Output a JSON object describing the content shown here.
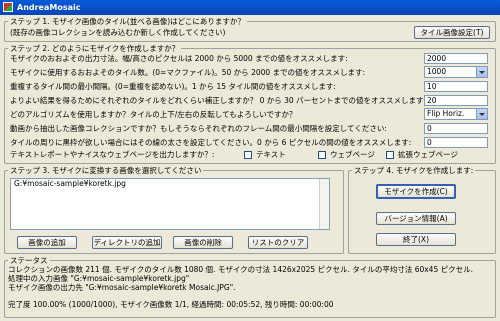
{
  "window": {
    "title": "AndreaMosaic"
  },
  "step1": {
    "legend": "ステップ 1. モザイク画像のタイル(並べる画像)はどこにありますか？",
    "hint": "(既存の画像コレクションを読み込むか新しく作成してください)",
    "button": "タイル画像設定(T)"
  },
  "step2": {
    "legend": "ステップ 2. どのようにモザイクを作成しますか？",
    "rows": [
      {
        "label": "モザイクのおおよその出力寸法。幅/高さのピクセルは 2000 から 5000 までの値をオススメします:",
        "value": "2000",
        "kind": "field"
      },
      {
        "label": "モザイクに使用するおおよそのタイル数。(0=マクファイル)。50 から 2000 までの値をオススメします:",
        "value": "1000",
        "kind": "combo"
      },
      {
        "label": "重複するタイル間の最小間隔。(0=重複を認めない)。1 から 15 タイル間の値をオススメします:",
        "value": "10",
        "kind": "field"
      },
      {
        "label": "よりよい結果を得るためにそれぞれのタイルをどれくらい補正しますか？  0 から 30 パーセントまでの値をオススメします:",
        "value": "20",
        "kind": "field"
      },
      {
        "label": "どのアルゴリズムを使用しますか？タイルの上下/左右の反転してもよろしいですか？",
        "value": "Flip Horiz.",
        "kind": "combo"
      },
      {
        "label": "動画から抽出した画像コレクションですか？もしそうならそれぞれのフレーム間の最小間隔を設定してください:",
        "value": "0",
        "kind": "field"
      },
      {
        "label": "タイルの周りに黒枠が欲しい場合にはその線の太さを設定してください。0 から 6 ピクセルの間の値をオススメします:",
        "value": "0",
        "kind": "field"
      }
    ],
    "text_question": "テキストレポートやナイスなウェブページを出力しますか？:",
    "checks": [
      {
        "label": "テキスト"
      },
      {
        "label": "ウェブページ"
      },
      {
        "label": "拡張ウェブページ"
      }
    ]
  },
  "step3": {
    "legend": "ステップ 3. モザイクに変換する画像を選択してください",
    "list_items": [
      "G:¥mosaic-sample¥koretk.jpg"
    ],
    "buttons": {
      "add_image": "画像の追加",
      "add_dir": "ディレクトリの追加",
      "delete_image": "画像の削除",
      "clear_list": "リストのクリア"
    }
  },
  "step4": {
    "legend": "ステップ 4. モザイクを作成します:",
    "create": "モザイクを作成(C)",
    "version": "バージョン情報(A)",
    "exit": "終了(X)"
  },
  "status": {
    "legend": "ステータス",
    "lines": [
      "コレクションの画像数 211 個. モザイクのタイル数 1080 個. モザイクの寸法 1426x2025 ピクセル. タイルの平均寸法 60x45 ピクセル.",
      "処理中の入力画像 \"G:¥mosaic-sample¥koretk.jpg\"",
      "モザイク画像の出力先 \"G:¥mosaic-sample¥koretk Mosaic.JPG\".",
      "",
      "完了度 100.00% (1000/1000), モザイク画像数 1/1, 経過時間: 00:05:52, 残り時間: 00:00:00"
    ]
  }
}
